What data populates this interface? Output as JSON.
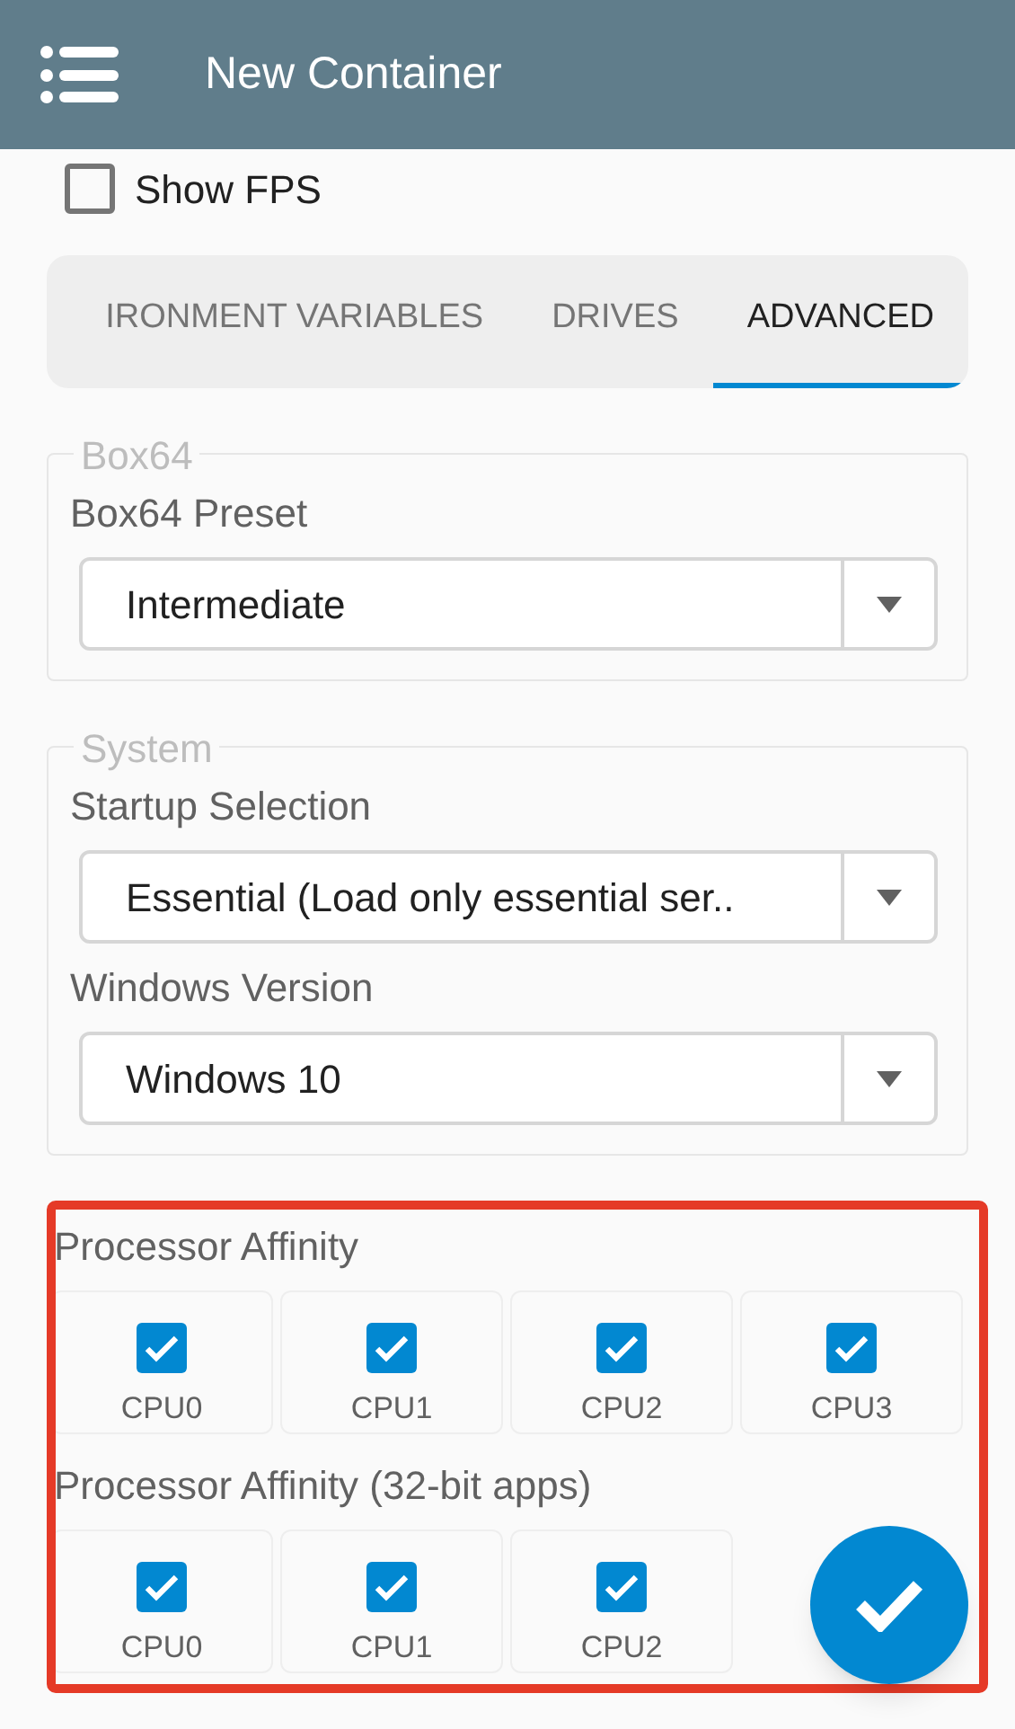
{
  "app_bar": {
    "title": "New Container"
  },
  "show_fps": {
    "label": "Show FPS",
    "checked": false
  },
  "tabs": [
    {
      "label": "IRONMENT VARIABLES",
      "selected": false
    },
    {
      "label": "DRIVES",
      "selected": false
    },
    {
      "label": "ADVANCED",
      "selected": true
    }
  ],
  "groups": [
    {
      "legend": "Box64",
      "fields": [
        {
          "label": "Box64 Preset",
          "value": "Intermediate"
        }
      ]
    },
    {
      "legend": "System",
      "fields": [
        {
          "label": "Startup Selection",
          "value": "Essential (Load only essential ser.."
        },
        {
          "label": "Windows Version",
          "value": "Windows 10"
        }
      ]
    }
  ],
  "affinity_sections": [
    {
      "title": "Processor Affinity",
      "cpus": [
        {
          "label": "CPU0",
          "checked": true
        },
        {
          "label": "CPU1",
          "checked": true
        },
        {
          "label": "CPU2",
          "checked": true
        },
        {
          "label": "CPU3",
          "checked": true
        }
      ]
    },
    {
      "title": "Processor Affinity (32-bit apps)",
      "cpus": [
        {
          "label": "CPU0",
          "checked": true
        },
        {
          "label": "CPU1",
          "checked": true
        },
        {
          "label": "CPU2",
          "checked": true
        }
      ]
    }
  ],
  "highlight": true
}
